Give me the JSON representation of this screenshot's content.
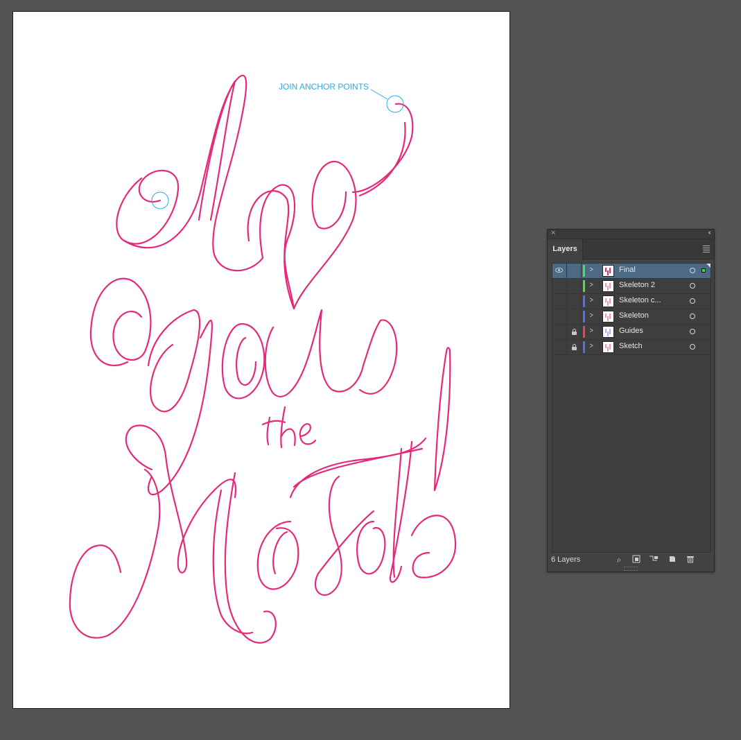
{
  "canvas": {
    "annotation_label": "JOIN ANCHOR POINTS",
    "annotation_color": "#29abe2",
    "lettering_color": "#e5297a",
    "artboard_color": "#ffffff",
    "workspace_color": "#535353"
  },
  "layers_panel": {
    "tab_title": "Layers",
    "close_glyph": "×",
    "collapse_glyph": "‹‹",
    "layers": [
      {
        "name": "Final",
        "visible": true,
        "locked": false,
        "color": "#4be04b",
        "selected": true
      },
      {
        "name": "Skeleton 2",
        "visible": false,
        "locked": false,
        "color": "#4be04b",
        "selected": false
      },
      {
        "name": "Skeleton c...",
        "visible": false,
        "locked": false,
        "color": "#4f6df5",
        "selected": false
      },
      {
        "name": "Skeleton",
        "visible": false,
        "locked": false,
        "color": "#4f6df5",
        "selected": false
      },
      {
        "name": "Guides",
        "visible": false,
        "locked": true,
        "color": "#e84848",
        "selected": false
      },
      {
        "name": "Sketch",
        "visible": false,
        "locked": true,
        "color": "#4f6df5",
        "selected": false
      }
    ],
    "footer": {
      "count_label": "6 Layers",
      "icons": [
        "locate-object-icon",
        "make-clipping-mask-icon",
        "create-sublayer-icon",
        "create-new-layer-icon",
        "delete-layer-icon"
      ]
    }
  }
}
